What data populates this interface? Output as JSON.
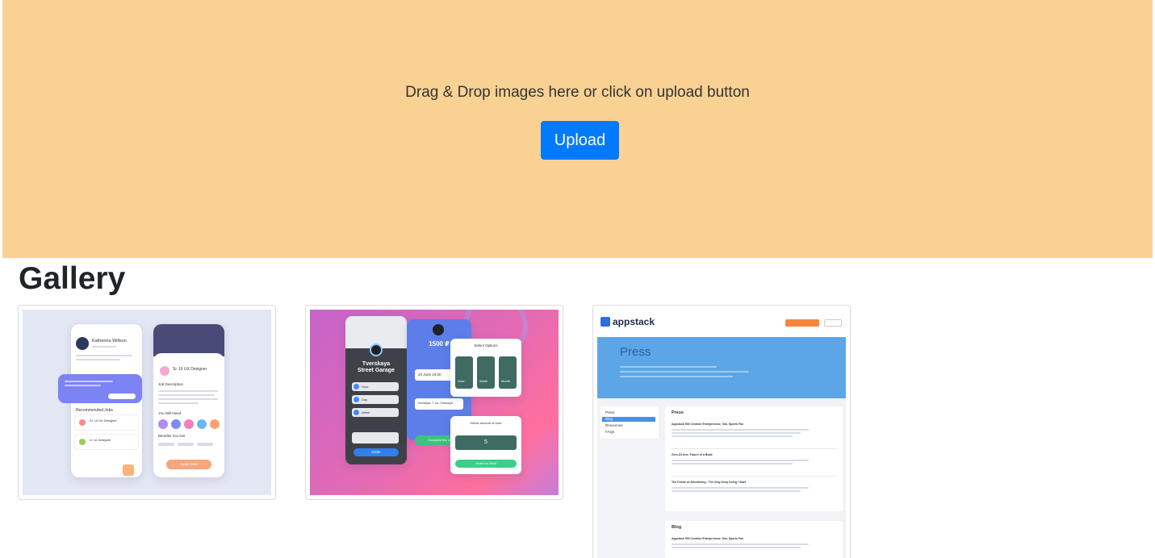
{
  "dropzone": {
    "hint": "Drag & Drop images here or click on upload button",
    "upload_label": "Upload",
    "background": "#f9d293",
    "button_color": "#007bff"
  },
  "gallery": {
    "title": "Gallery",
    "items": [
      {
        "kind": "job-app-mockup",
        "profile_name": "Katherina Willson",
        "job_title": "Sr. UI UX Designer",
        "section_job_description": "Job Description",
        "section_recommended": "Recommended Jobs",
        "section_you_will_need": "You Will Need",
        "section_benefits": "Benefits You Get",
        "apply_label": "Apply Now",
        "rec_job_1": "Sr. UI UX Designer",
        "rec_job_2": "Jr. UI Designer"
      },
      {
        "kind": "parking-app-mockup",
        "garage_name_1": "Tverskaya",
        "garage_name_2": "Street Garage",
        "price": "1500 ₽",
        "date": "23 June 19:00",
        "address": "Tverskaya, 7, str. Tverskaya",
        "options_title": "Select Options",
        "opt_1": "Hour",
        "opt_2": "Week",
        "opt_3": "Month",
        "row_1": "Hour",
        "row_2": "Day",
        "row_3": "Week",
        "order_label": "Order",
        "complete_label": "Complete the order",
        "amount_title": "Select amount of hour",
        "amount_value": "5",
        "pay_label": "Order for 3500"
      },
      {
        "kind": "appstack-mockup",
        "brand": "appstack",
        "hero_title": "Press",
        "menu": [
          "Press",
          "Blog",
          "Resources",
          "FAQs"
        ],
        "section_1": "Press",
        "section_2": "Blog",
        "article_1": "Appstack 500 Creative Entrepreneur; Sim, Sports Fan",
        "article_2": "Zero-Of-One: Future of a Build",
        "article_3": "The Future of Advertising - The Only Keep Going / Start",
        "article_4": "Appstack 500 Creative Entrepreneur; Sim, Sports Fan"
      }
    ]
  }
}
